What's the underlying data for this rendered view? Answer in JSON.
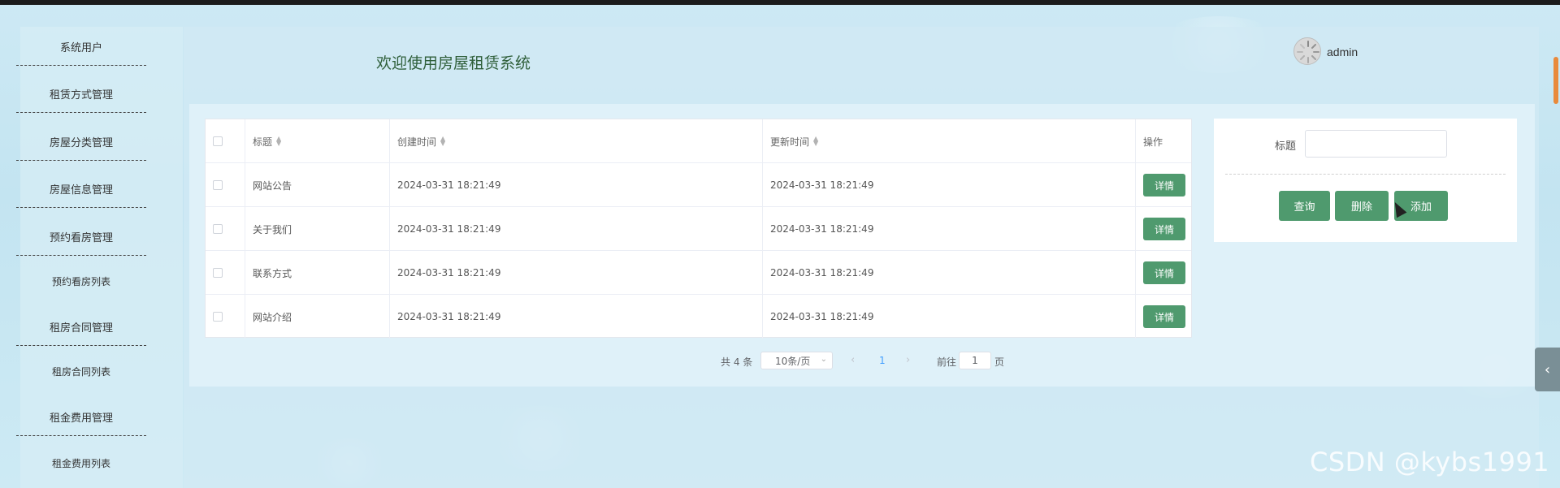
{
  "header": {
    "welcome": "欢迎使用房屋租赁系统",
    "username": "admin"
  },
  "sidebar": {
    "items": [
      {
        "label": "系统用户"
      },
      {
        "label": "租赁方式管理"
      },
      {
        "label": "房屋分类管理"
      },
      {
        "label": "房屋信息管理"
      },
      {
        "label": "预约看房管理"
      },
      {
        "label": "预约看房列表"
      },
      {
        "label": "租房合同管理"
      },
      {
        "label": "租房合同列表"
      },
      {
        "label": "租金费用管理"
      },
      {
        "label": "租金费用列表"
      }
    ]
  },
  "table": {
    "columns": {
      "title": "标题",
      "created": "创建时间",
      "updated": "更新时间",
      "actions": "操作"
    },
    "rows": [
      {
        "title": "网站公告",
        "created": "2024-03-31 18:21:49",
        "updated": "2024-03-31 18:21:49",
        "action": "详情"
      },
      {
        "title": "关于我们",
        "created": "2024-03-31 18:21:49",
        "updated": "2024-03-31 18:21:49",
        "action": "详情"
      },
      {
        "title": "联系方式",
        "created": "2024-03-31 18:21:49",
        "updated": "2024-03-31 18:21:49",
        "action": "详情"
      },
      {
        "title": "网站介绍",
        "created": "2024-03-31 18:21:49",
        "updated": "2024-03-31 18:21:49",
        "action": "详情"
      }
    ]
  },
  "pagination": {
    "total": "共 4 条",
    "page_size": "10条/页",
    "current_page": "1",
    "goto_prefix": "前往",
    "goto_value": "1",
    "goto_suffix": "页"
  },
  "search": {
    "label": "标题",
    "value": "",
    "query": "查询",
    "delete": "删除",
    "add": "添加"
  },
  "watermark": "CSDN @kybs1991",
  "colors": {
    "accent": "#4f9a6e",
    "background": "#c3e4f1"
  }
}
